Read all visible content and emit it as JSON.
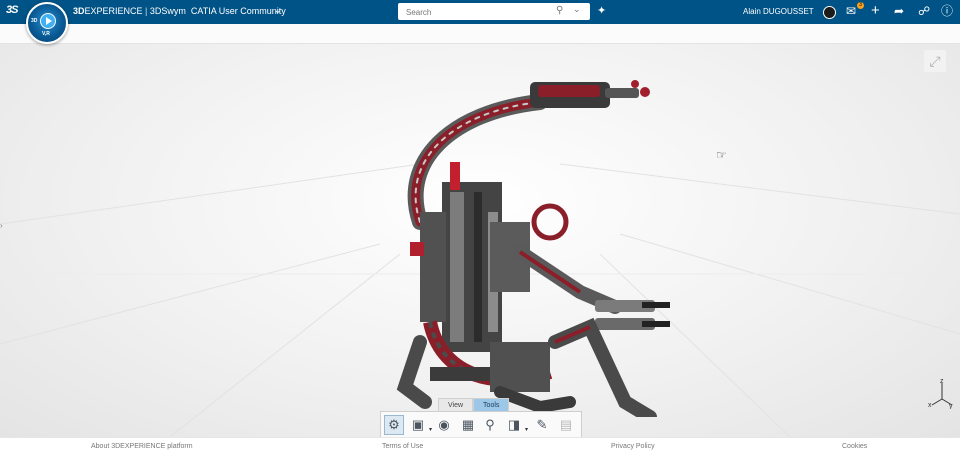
{
  "topbar": {
    "logo": "3S",
    "compass": {
      "label_3d": "3D",
      "label_vr": "V,R"
    },
    "app_brand": "3D",
    "app_brand_rest": "EXPERIENCE",
    "app_sep": " | ",
    "app_name": "3DSwym",
    "community": "CATIA User Community",
    "search_placeholder": "Search",
    "user_name": "Alain DUGOUSSET",
    "notification_count": "3",
    "icons": [
      "search-icon",
      "tag-icon",
      "notifications-icon",
      "add-icon",
      "share-icon",
      "network-icon",
      "help-icon"
    ]
  },
  "viewer": {
    "tabs": [
      "View",
      "Tools"
    ],
    "active_tab": "Tools",
    "axis_labels": {
      "x": "x",
      "y": "y",
      "z": "z"
    },
    "tools": [
      "compass-tool",
      "capture-tool",
      "visibility-tool",
      "explode-tool",
      "zoom-tool",
      "section-tool",
      "annotate-tool",
      "markup-tool"
    ]
  },
  "footer": {
    "about": "About 3DEXPERIENCE platform",
    "terms": "Terms of Use",
    "privacy": "Privacy Policy",
    "cookies": "Cookies"
  },
  "colors": {
    "topbar": "#005386",
    "accent": "#3fb0f2",
    "model_red": "#8a1f2a",
    "badge": "#f6a21e"
  }
}
